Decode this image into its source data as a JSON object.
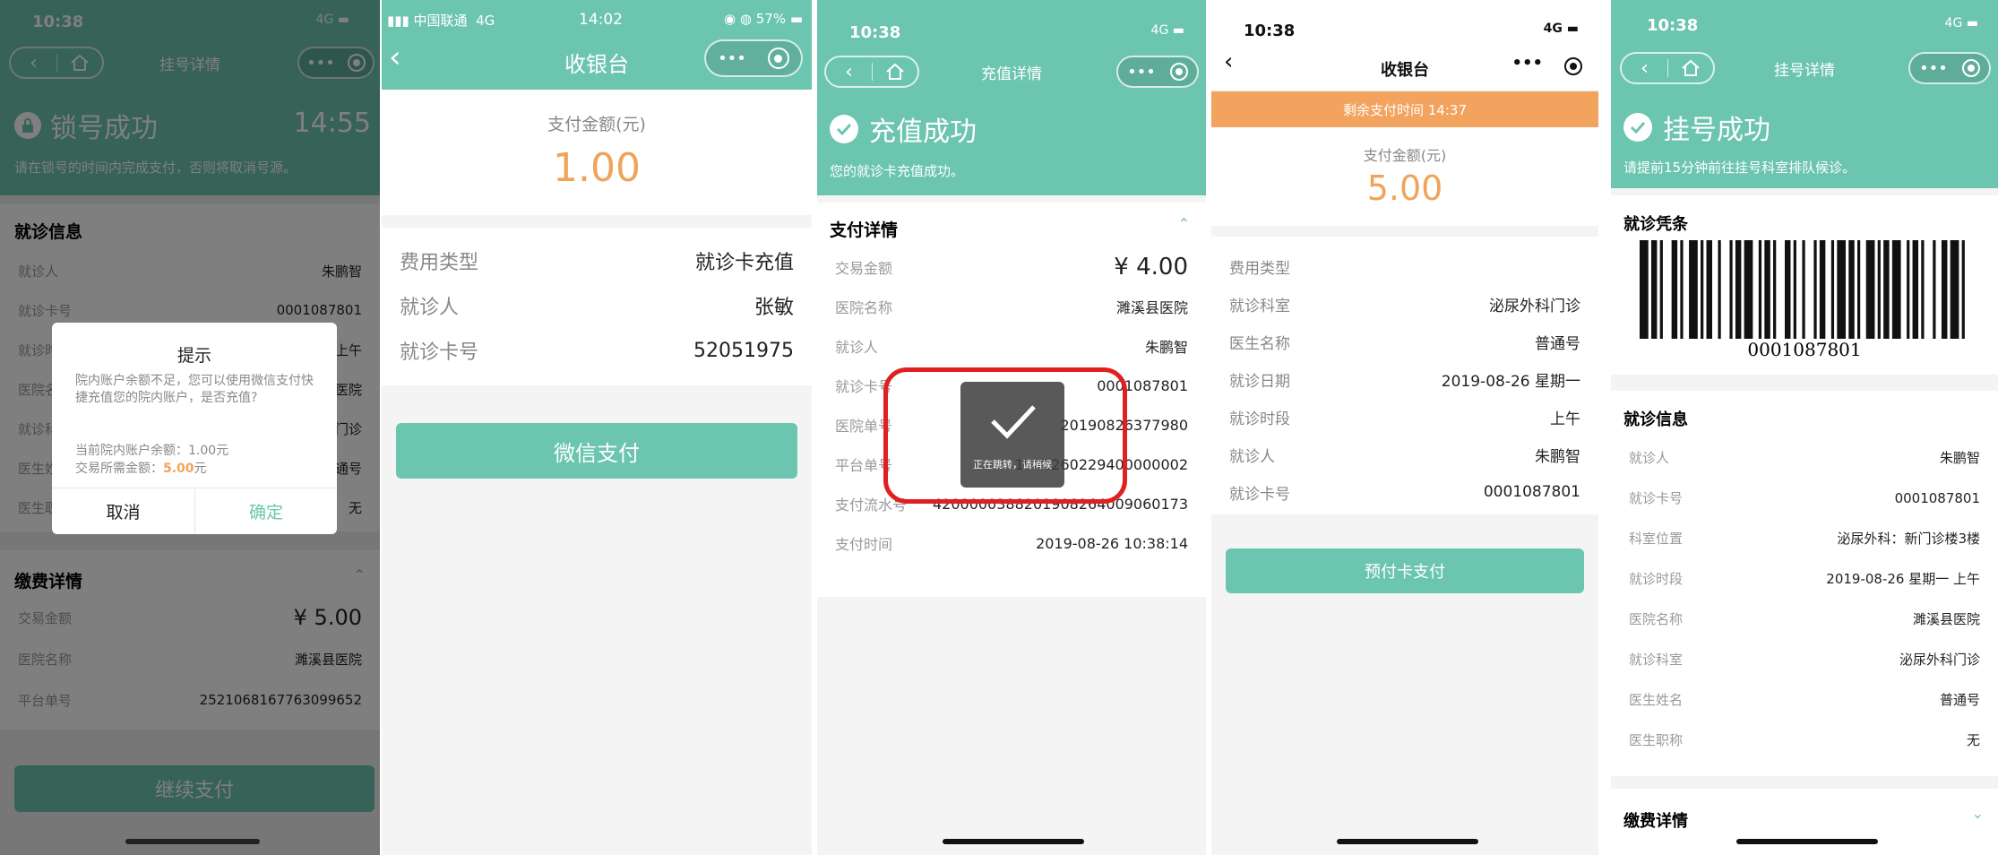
{
  "p1": {
    "time": "10:38",
    "signal": "4G",
    "title": "挂号详情",
    "banner_title": "锁号成功",
    "banner_timer": "14:55",
    "banner_sub": "请在锁号的时间内完成支付，否则将取消号源。",
    "section1": "就诊信息",
    "rows": [
      {
        "l": "就诊人",
        "v": "朱鹏智"
      },
      {
        "l": "就诊卡号",
        "v": "0001087801"
      },
      {
        "l": "就诊时段",
        "v": "- 上午"
      },
      {
        "l": "医院名称",
        "v": "瀍医院"
      },
      {
        "l": "就诊科室",
        "v": "科门诊"
      },
      {
        "l": "医生姓名",
        "v": "普通号"
      },
      {
        "l": "医生职称",
        "v": "无"
      }
    ],
    "section2": "缴费详情",
    "pay_rows": [
      {
        "l": "交易金额",
        "v": "¥ 5.00"
      },
      {
        "l": "医院名称",
        "v": "濉溪县医院"
      },
      {
        "l": "平台单号",
        "v": "2521068167763099652"
      }
    ],
    "pay_button": "继续支付",
    "dialog": {
      "title": "提示",
      "body": "院内账户余额不足，您可以使用微信支付快捷充值您的院内账户，是否充值?",
      "balance": "当前院内账户余额：1.00元",
      "need_prefix": "交易所需金额：",
      "need_amount": "5.00",
      "need_suffix": "元",
      "cancel": "取消",
      "confirm": "确定"
    }
  },
  "p2": {
    "carrier": "中国联通",
    "signal": "4G",
    "time": "14:02",
    "battery": "57%",
    "title": "收银台",
    "amount_label": "支付金额(元)",
    "amount": "1.00",
    "rows": [
      {
        "l": "费用类型",
        "v": "就诊卡充值"
      },
      {
        "l": "就诊人",
        "v": "张敏"
      },
      {
        "l": "就诊卡号",
        "v": "52051975"
      }
    ],
    "button": "微信支付"
  },
  "p3": {
    "time": "10:38",
    "signal": "4G",
    "title": "充值详情",
    "banner_title": "充值成功",
    "banner_sub": "您的就诊卡充值成功。",
    "section": "支付详情",
    "rows": [
      {
        "l": "交易金额",
        "v": "¥ 4.00"
      },
      {
        "l": "医院名称",
        "v": "濉溪县医院"
      },
      {
        "l": "就诊人",
        "v": "朱鹏智"
      },
      {
        "l": "就诊卡号",
        "v": "0001087801"
      },
      {
        "l": "医院单号",
        "v": "20190826377980"
      },
      {
        "l": "平台单号",
        "v": "1908260229400000002"
      },
      {
        "l": "支付流水号",
        "v": "4200000388201908264009060173"
      },
      {
        "l": "支付时间",
        "v": "2019-08-26 10:38:14"
      }
    ],
    "toast": "正在跳转，请稍候",
    "highlight_color": "#e02020"
  },
  "p4": {
    "time": "10:38",
    "signal": "4G",
    "title": "收银台",
    "notice": "剩余支付时间 14:37",
    "amount_label": "支付金额(元)",
    "amount": "5.00",
    "rows": [
      {
        "l": "费用类型",
        "v": ""
      },
      {
        "l": "就诊科室",
        "v": "泌尿外科门诊"
      },
      {
        "l": "医生名称",
        "v": "普通号"
      },
      {
        "l": "就诊日期",
        "v": "2019-08-26 星期一"
      },
      {
        "l": "就诊时段",
        "v": "上午"
      },
      {
        "l": "就诊人",
        "v": "朱鹏智"
      },
      {
        "l": "就诊卡号",
        "v": "0001087801"
      }
    ],
    "button": "预付卡支付"
  },
  "p5": {
    "time": "10:38",
    "signal": "4G",
    "title": "挂号详情",
    "banner_title": "挂号成功",
    "banner_sub": "请提前15分钟前往挂号科室排队候诊。",
    "voucher": "就诊凭条",
    "barcode_text": "0001087801",
    "section1": "就诊信息",
    "rows": [
      {
        "l": "就诊人",
        "v": "朱鹏智"
      },
      {
        "l": "就诊卡号",
        "v": "0001087801"
      },
      {
        "l": "科室位置",
        "v": "泌尿外科：新门诊楼3楼"
      },
      {
        "l": "就诊时段",
        "v": "2019-08-26 星期一 上午"
      },
      {
        "l": "医院名称",
        "v": "濉溪县医院"
      },
      {
        "l": "就诊科室",
        "v": "泌尿外科门诊"
      },
      {
        "l": "医生姓名",
        "v": "普通号"
      },
      {
        "l": "医生职称",
        "v": "无"
      }
    ],
    "section2": "缴费详情"
  },
  "colors": {
    "primary": "#6cc5ae",
    "primary_dark": "#3e7a6b",
    "orange": "#f2a35e",
    "amount_orange": "#f0a45a"
  }
}
